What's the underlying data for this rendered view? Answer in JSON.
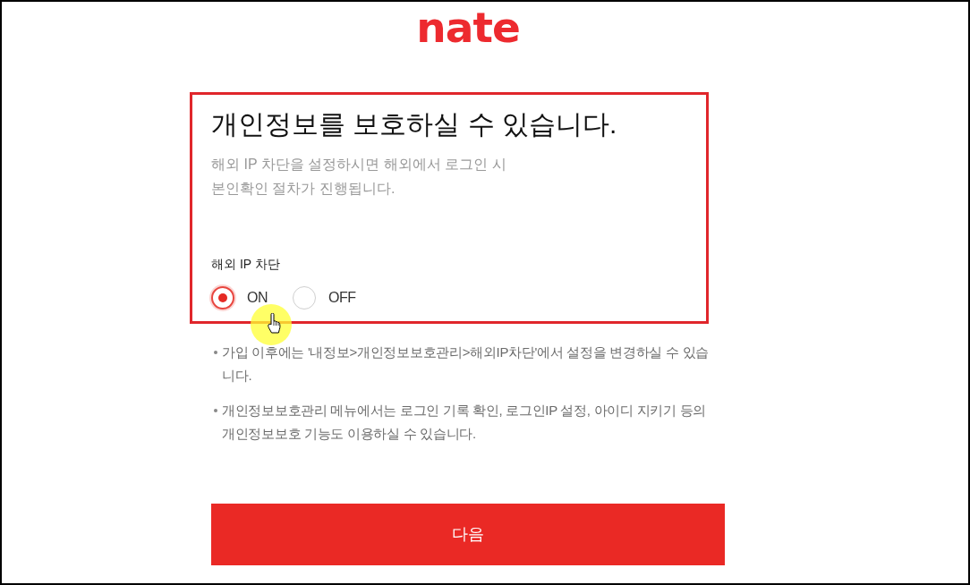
{
  "logo": {
    "text": "nate"
  },
  "notice": {
    "title": "개인정보를 보호하실 수 있습니다.",
    "description": [
      "해외 IP 차단을 설정하시면 해외에서 로그인 시",
      "본인확인 절차가 진행됩니다."
    ]
  },
  "ip_block": {
    "label": "해외 IP 차단",
    "options": [
      {
        "label": "ON",
        "selected": true
      },
      {
        "label": "OFF",
        "selected": false
      }
    ]
  },
  "notes": [
    "가입 이후에는 '내정보>개인정보보호관리>해외IP차단'에서 설정을 변경하실 수 있습니다.",
    "개인정보보호관리 메뉴에서는 로그인 기록 확인, 로그인IP 설정, 아이디 지키기 등의 개인정보보호 기능도 이용하실 수 있습니다."
  ],
  "next_button": {
    "label": "다음"
  }
}
